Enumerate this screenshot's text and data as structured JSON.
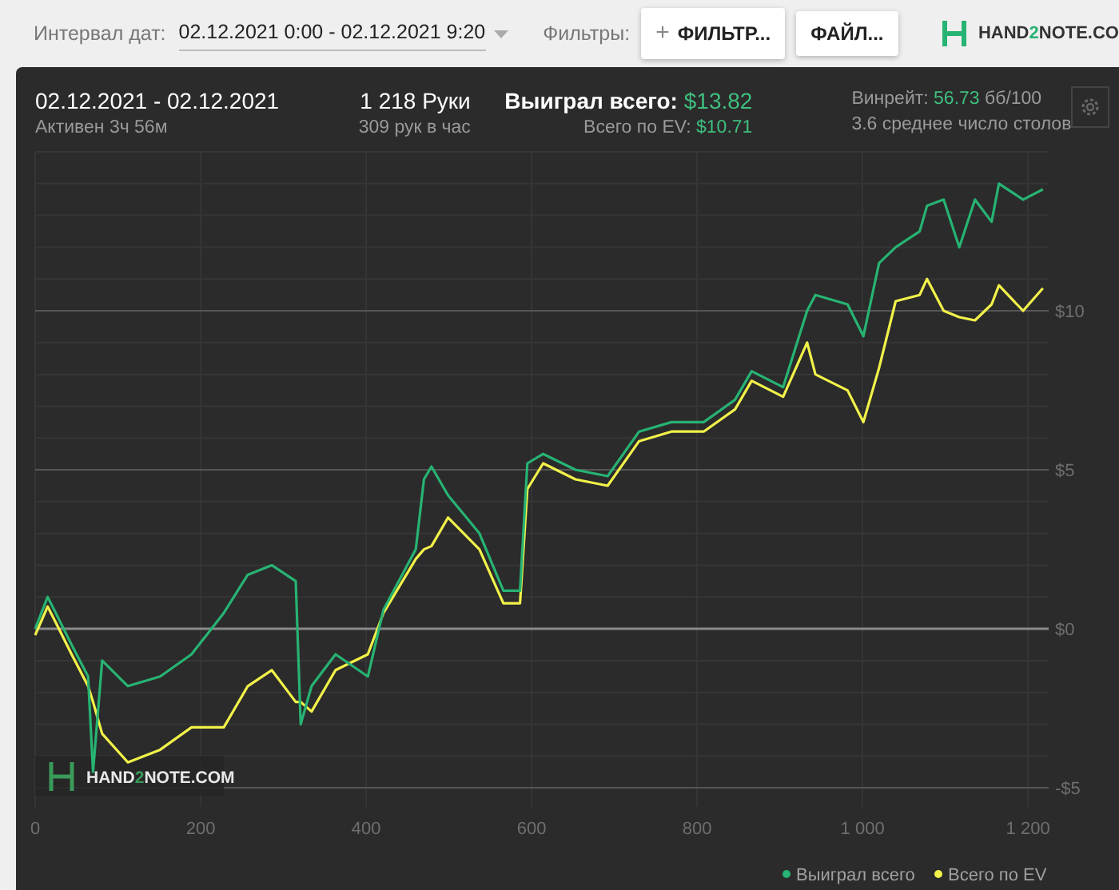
{
  "toolbar": {
    "interval_label": "Интервал дат:",
    "interval_value": "02.12.2021 0:00 - 02.12.2021 9:20",
    "filters_label": "Фильтры:",
    "filter_button": {
      "icon": "+",
      "label": "ФИЛЬТР..."
    },
    "file_button": "ФАЙЛ...",
    "logo": {
      "before": "HAND",
      "accent": "2",
      "after": "NOTE.CO"
    }
  },
  "summary": {
    "date_range": "02.12.2021 - 02.12.2021",
    "active": "Активен 3ч 56м",
    "hands": "1 218 Руки",
    "hands_per_hour": "309 рук в час",
    "won_label": "Выиграл всего:",
    "won_value": "$13.82",
    "ev_label": "Всего по EV:",
    "ev_value": "$10.71",
    "winrate_label": "Винрейт:",
    "winrate_value": "56.73",
    "winrate_unit": "бб/100",
    "tables": "3.6 среднее число столов"
  },
  "chart": {
    "watermark": {
      "before": "HAND",
      "accent": "2",
      "after": "NOTE.COM"
    },
    "chart_data": {
      "type": "line",
      "xlim": [
        0,
        1225
      ],
      "ylim": [
        -5.6,
        15
      ],
      "grid": true,
      "legend": true,
      "xticks": [
        0,
        200,
        400,
        600,
        800,
        {
          "value": 1000,
          "label": "1 000"
        },
        {
          "value": 1200,
          "label": "1 200"
        }
      ],
      "yticks": [
        {
          "value": 10,
          "label": "$10"
        },
        {
          "value": 5,
          "label": "$5"
        },
        {
          "value": 0,
          "label": "$0"
        },
        {
          "value": -5,
          "label": "-$5"
        }
      ],
      "x": [
        0,
        15,
        25,
        44,
        64,
        70,
        81,
        112,
        151,
        189,
        228,
        257,
        286,
        315,
        321,
        334,
        363,
        402,
        421,
        460,
        470,
        479,
        499,
        537,
        566,
        586,
        595,
        614,
        653,
        692,
        730,
        769,
        808,
        846,
        866,
        904,
        933,
        943,
        982,
        1001,
        1020,
        1040,
        1069,
        1078,
        1098,
        1117,
        1136,
        1156,
        1165,
        1194,
        1218
      ],
      "series": [
        {
          "name": "Выиграл всего",
          "color": "#27b373",
          "values": [
            0,
            1.0,
            0.5,
            -0.5,
            -1.5,
            -4.5,
            -1.0,
            -1.8,
            -1.5,
            -0.8,
            0.5,
            1.7,
            2.0,
            1.5,
            -3.0,
            -1.8,
            -0.8,
            -1.5,
            0.6,
            2.5,
            4.7,
            5.1,
            4.2,
            3.0,
            1.2,
            1.2,
            5.2,
            5.5,
            5.0,
            4.8,
            6.2,
            6.5,
            6.5,
            7.2,
            8.1,
            7.6,
            10.0,
            10.5,
            10.2,
            9.2,
            11.5,
            12.0,
            12.5,
            13.3,
            13.5,
            12.0,
            13.5,
            12.8,
            14.0,
            13.5,
            13.82
          ]
        },
        {
          "name": "Всего по EV",
          "color": "#f2f24a",
          "values": [
            -0.2,
            0.7,
            0.2,
            -0.8,
            -1.8,
            -2.3,
            -3.3,
            -4.2,
            -3.8,
            -3.1,
            -3.1,
            -1.8,
            -1.3,
            -2.3,
            -2.3,
            -2.6,
            -1.3,
            -0.8,
            0.5,
            2.2,
            2.5,
            2.6,
            3.5,
            2.5,
            0.8,
            0.8,
            4.4,
            5.2,
            4.7,
            4.5,
            5.9,
            6.2,
            6.2,
            6.9,
            7.8,
            7.3,
            9.0,
            8.0,
            7.5,
            6.5,
            8.2,
            10.3,
            10.5,
            11.0,
            10.0,
            9.8,
            9.7,
            10.2,
            10.8,
            10.0,
            10.71
          ]
        }
      ]
    }
  }
}
